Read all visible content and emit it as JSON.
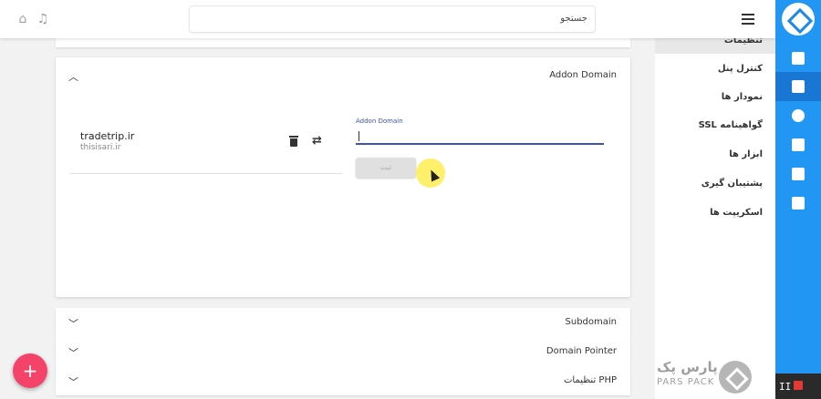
{
  "header": {
    "search_placeholder": "جستجو"
  },
  "sidemenu": {
    "items": [
      {
        "label": "تنظیمات"
      },
      {
        "label": "کنترل پنل"
      },
      {
        "label": "نمودار ها"
      },
      {
        "label": "گواهینامه SSL"
      },
      {
        "label": "ابزار ها"
      },
      {
        "label": "پشتیبان گیری"
      },
      {
        "label": "اسکریپت ها"
      }
    ]
  },
  "addon": {
    "title": "Addon Domain",
    "domain_name": "tradetrip.ir",
    "domain_sub": "thisisari.ir",
    "field_label": "Addon Domain",
    "field_value": "",
    "submit_label": "ثبت"
  },
  "panels": [
    {
      "title": "Subdomain"
    },
    {
      "title": "Domain Pointer"
    },
    {
      "title": "تنظیمات PHP"
    }
  ],
  "fab": {
    "label": "+"
  },
  "watermark": {
    "fa": "پارس پک",
    "en": "PARS PACK"
  },
  "media": {
    "pause_label": "II"
  },
  "icons": {
    "home": "home-icon",
    "bell": "notification-icon",
    "menu": "hamburger-icon",
    "trash": "trash-icon",
    "swap": "swap-icon",
    "chevron_up": "chevron-up-icon",
    "chevron_down": "chevron-down-icon"
  },
  "colors": {
    "rail": "#2196f3",
    "accent": "#3f51b5",
    "fab": "#f44369"
  }
}
